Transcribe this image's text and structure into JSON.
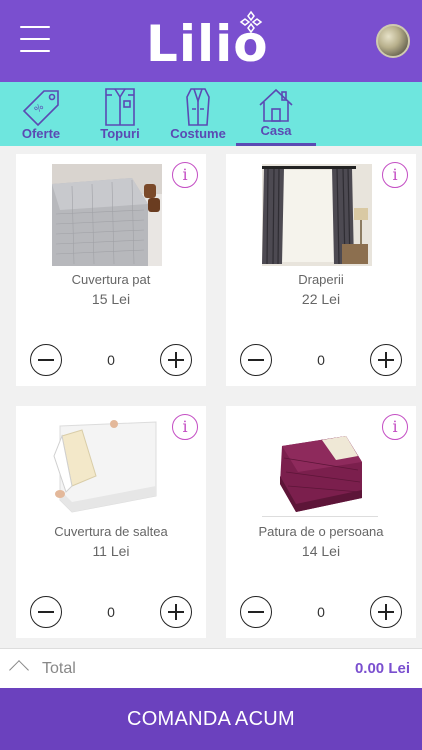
{
  "header": {
    "logo": "Lilio",
    "menu_icon": "hamburger-menu-icon",
    "avatar": "user-avatar",
    "colors": {
      "header_bg": "#7a4fcf",
      "tabs_bg": "#6ee6de",
      "accent": "#5b4ab3"
    }
  },
  "tabs": [
    {
      "label": "Oferte",
      "icon": "price-tag-icon",
      "active": false
    },
    {
      "label": "Topuri",
      "icon": "shirt-icon",
      "active": false
    },
    {
      "label": "Costume",
      "icon": "suit-icon",
      "active": false
    },
    {
      "label": "Casa",
      "icon": "house-icon",
      "active": true
    }
  ],
  "products": [
    {
      "name": "Cuvertura pat",
      "price": "15 Lei",
      "qty": "0",
      "image": "bedspread-image"
    },
    {
      "name": "Draperii",
      "price": "22 Lei",
      "qty": "0",
      "image": "curtains-image"
    },
    {
      "name": "Cuvertura de saltea",
      "price": "11 Lei",
      "qty": "0",
      "image": "mattress-cover-image"
    },
    {
      "name": "Patura de o persoana",
      "price": "14 Lei",
      "qty": "0",
      "image": "blanket-image"
    }
  ],
  "footer": {
    "total_label": "Total",
    "total_value": "0.00 Lei",
    "order_button": "COMANDA ACUM"
  }
}
